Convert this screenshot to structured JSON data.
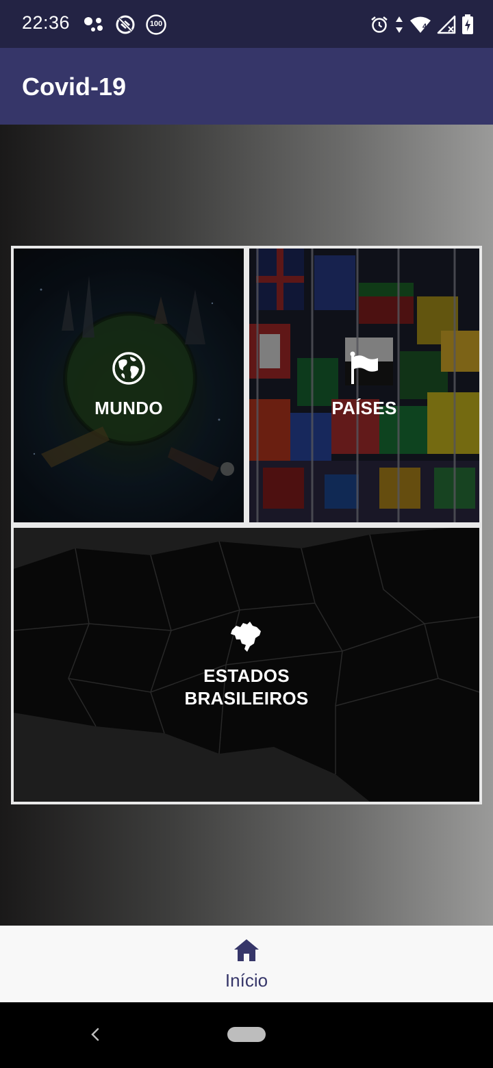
{
  "status_bar": {
    "time": "22:36",
    "left_icons": [
      "assistant-dots-icon",
      "do-not-disturb-icon",
      "battery-saver-100-icon"
    ],
    "battery_saver_text": "100",
    "right_icons": [
      "alarm-icon",
      "data-arrows-icon",
      "wifi-icon",
      "cell-signal-icon",
      "battery-charging-icon"
    ],
    "network_label": "4"
  },
  "app_bar": {
    "title": "Covid-19",
    "color": "#363669"
  },
  "tiles": {
    "world": {
      "label": "MUNDO",
      "icon": "globe-icon"
    },
    "countries": {
      "label": "PAÍSES",
      "icon": "flag-icon"
    },
    "states": {
      "label_line1": "ESTADOS",
      "label_line2": "BRASILEIROS",
      "icon": "brazil-map-icon"
    }
  },
  "bottom_nav": {
    "items": [
      {
        "label": "Início",
        "icon": "home-icon",
        "selected": true
      }
    ],
    "accent": "#363669"
  },
  "system_nav": {
    "icons": [
      "back-icon",
      "home-pill"
    ]
  }
}
